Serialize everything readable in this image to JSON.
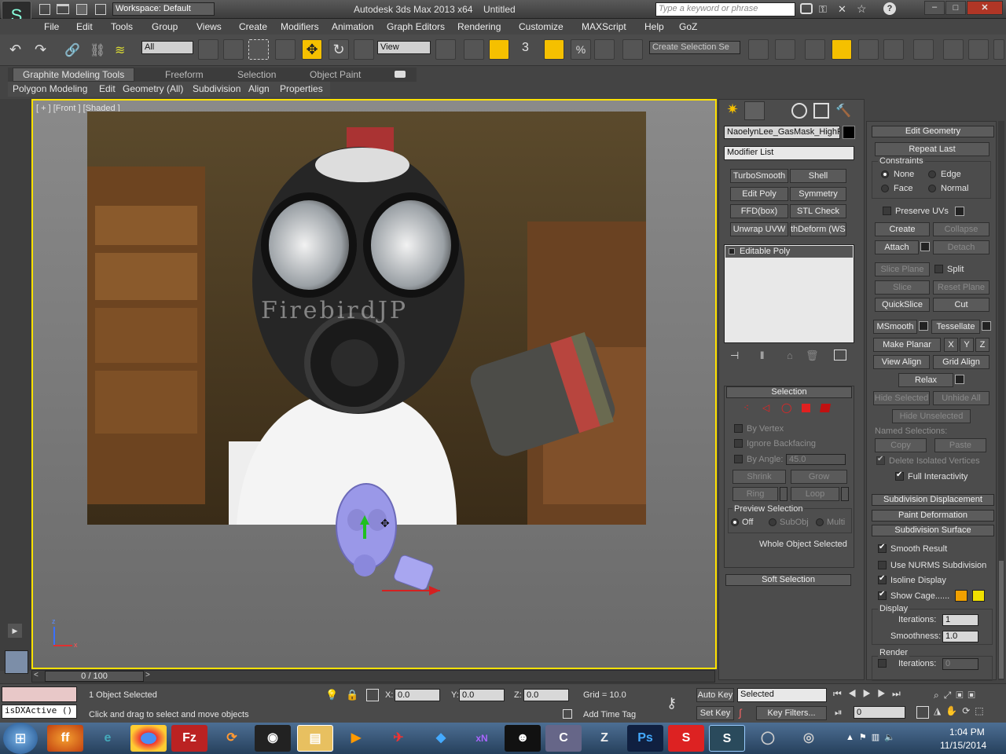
{
  "window": {
    "app_title": "Autodesk 3ds Max  2013 x64",
    "doc_title": "Untitled",
    "workspace": "Workspace: Default",
    "search_placeholder": "Type a keyword or phrase"
  },
  "menu": [
    "File",
    "Edit",
    "Tools",
    "Group",
    "Views",
    "Create",
    "Modifiers",
    "Animation",
    "Graph Editors",
    "Rendering",
    "Customize",
    "MAXScript",
    "Help",
    "GoZ"
  ],
  "toolbar": {
    "filter": "All",
    "ref_coord": "View",
    "angle_snap": "3",
    "named_selection": "Create Selection Se"
  },
  "ribbon": {
    "tabs": [
      "Graphite Modeling Tools",
      "Freeform",
      "Selection",
      "Object Paint"
    ],
    "sub": [
      "Polygon Modeling",
      "Edit",
      "Geometry (All)",
      "Subdivision",
      "Align",
      "Properties"
    ]
  },
  "viewport": {
    "label": "[ + ] [Front ] [Shaded ]",
    "watermark": "FirebirdJP",
    "axis_z": "z",
    "axis_x": "x"
  },
  "timeline": {
    "frame": "0 / 100"
  },
  "modify": {
    "object_name": "NaoelynLee_GasMask_HighPo",
    "modifier_list": "Modifier List",
    "modifier_buttons": [
      "TurboSmooth",
      "Shell",
      "Edit Poly",
      "Symmetry",
      "FFD(box)",
      "STL Check",
      "Unwrap UVW",
      "thDeform (WSI"
    ],
    "stack_item": "Editable Poly",
    "selection": {
      "title": "Selection",
      "by_vertex": "By Vertex",
      "ignore_backfacing": "Ignore Backfacing",
      "by_angle": "By Angle:",
      "angle_value": "45.0",
      "shrink": "Shrink",
      "grow": "Grow",
      "ring": "Ring",
      "loop": "Loop",
      "preview_title": "Preview Selection",
      "preview_opts": [
        "Off",
        "SubObj",
        "Multi"
      ],
      "status": "Whole Object Selected"
    },
    "soft_selection": "Soft Selection"
  },
  "edit_geometry": {
    "title": "Edit Geometry",
    "repeat_last": "Repeat Last",
    "constraints": "Constraints",
    "c_none": "None",
    "c_edge": "Edge",
    "c_face": "Face",
    "c_normal": "Normal",
    "preserve_uvs": "Preserve UVs",
    "create": "Create",
    "collapse": "Collapse",
    "attach": "Attach",
    "detach": "Detach",
    "slice_plane": "Slice Plane",
    "split": "Split",
    "slice": "Slice",
    "reset_plane": "Reset Plane",
    "quickslice": "QuickSlice",
    "cut": "Cut",
    "msmooth": "MSmooth",
    "tessellate": "Tessellate",
    "make_planar": "Make Planar",
    "x": "X",
    "y": "Y",
    "z": "Z",
    "view_align": "View Align",
    "grid_align": "Grid Align",
    "relax": "Relax",
    "hide_selected": "Hide Selected",
    "unhide_all": "Unhide All",
    "hide_unselected": "Hide Unselected",
    "named_selections": "Named Selections:",
    "copy": "Copy",
    "paste": "Paste",
    "delete_isolated": "Delete Isolated Vertices",
    "full_interactivity": "Full Interactivity"
  },
  "subdiv": {
    "displacement": "Subdivision Displacement",
    "paint_deformation": "Paint Deformation",
    "surface": "Subdivision Surface",
    "smooth_result": "Smooth Result",
    "use_nurms": "Use NURMS Subdivision",
    "isoline": "Isoline Display",
    "show_cage": "Show Cage......",
    "display": "Display",
    "iterations": "Iterations:",
    "iter_value": "1",
    "smoothness": "Smoothness:",
    "smooth_value": "1.0",
    "render": "Render",
    "render_iter": "0",
    "cage_color1": "#f0a000",
    "cage_color2": "#f0e000"
  },
  "status": {
    "listener": "isDXActive ()",
    "selected": "1 Object Selected",
    "prompt": "Click and drag to select and move objects",
    "x": "0.0",
    "y": "0.0",
    "z": "0.0",
    "grid": "Grid = 10.0",
    "add_time_tag": "Add Time Tag",
    "auto_key": "Auto Key",
    "set_key": "Set Key",
    "key_mode": "Selected",
    "key_filters": "Key Filters...",
    "frame_field": "0"
  },
  "taskbar": {
    "time": "1:04 PM",
    "date": "11/15/2014"
  }
}
